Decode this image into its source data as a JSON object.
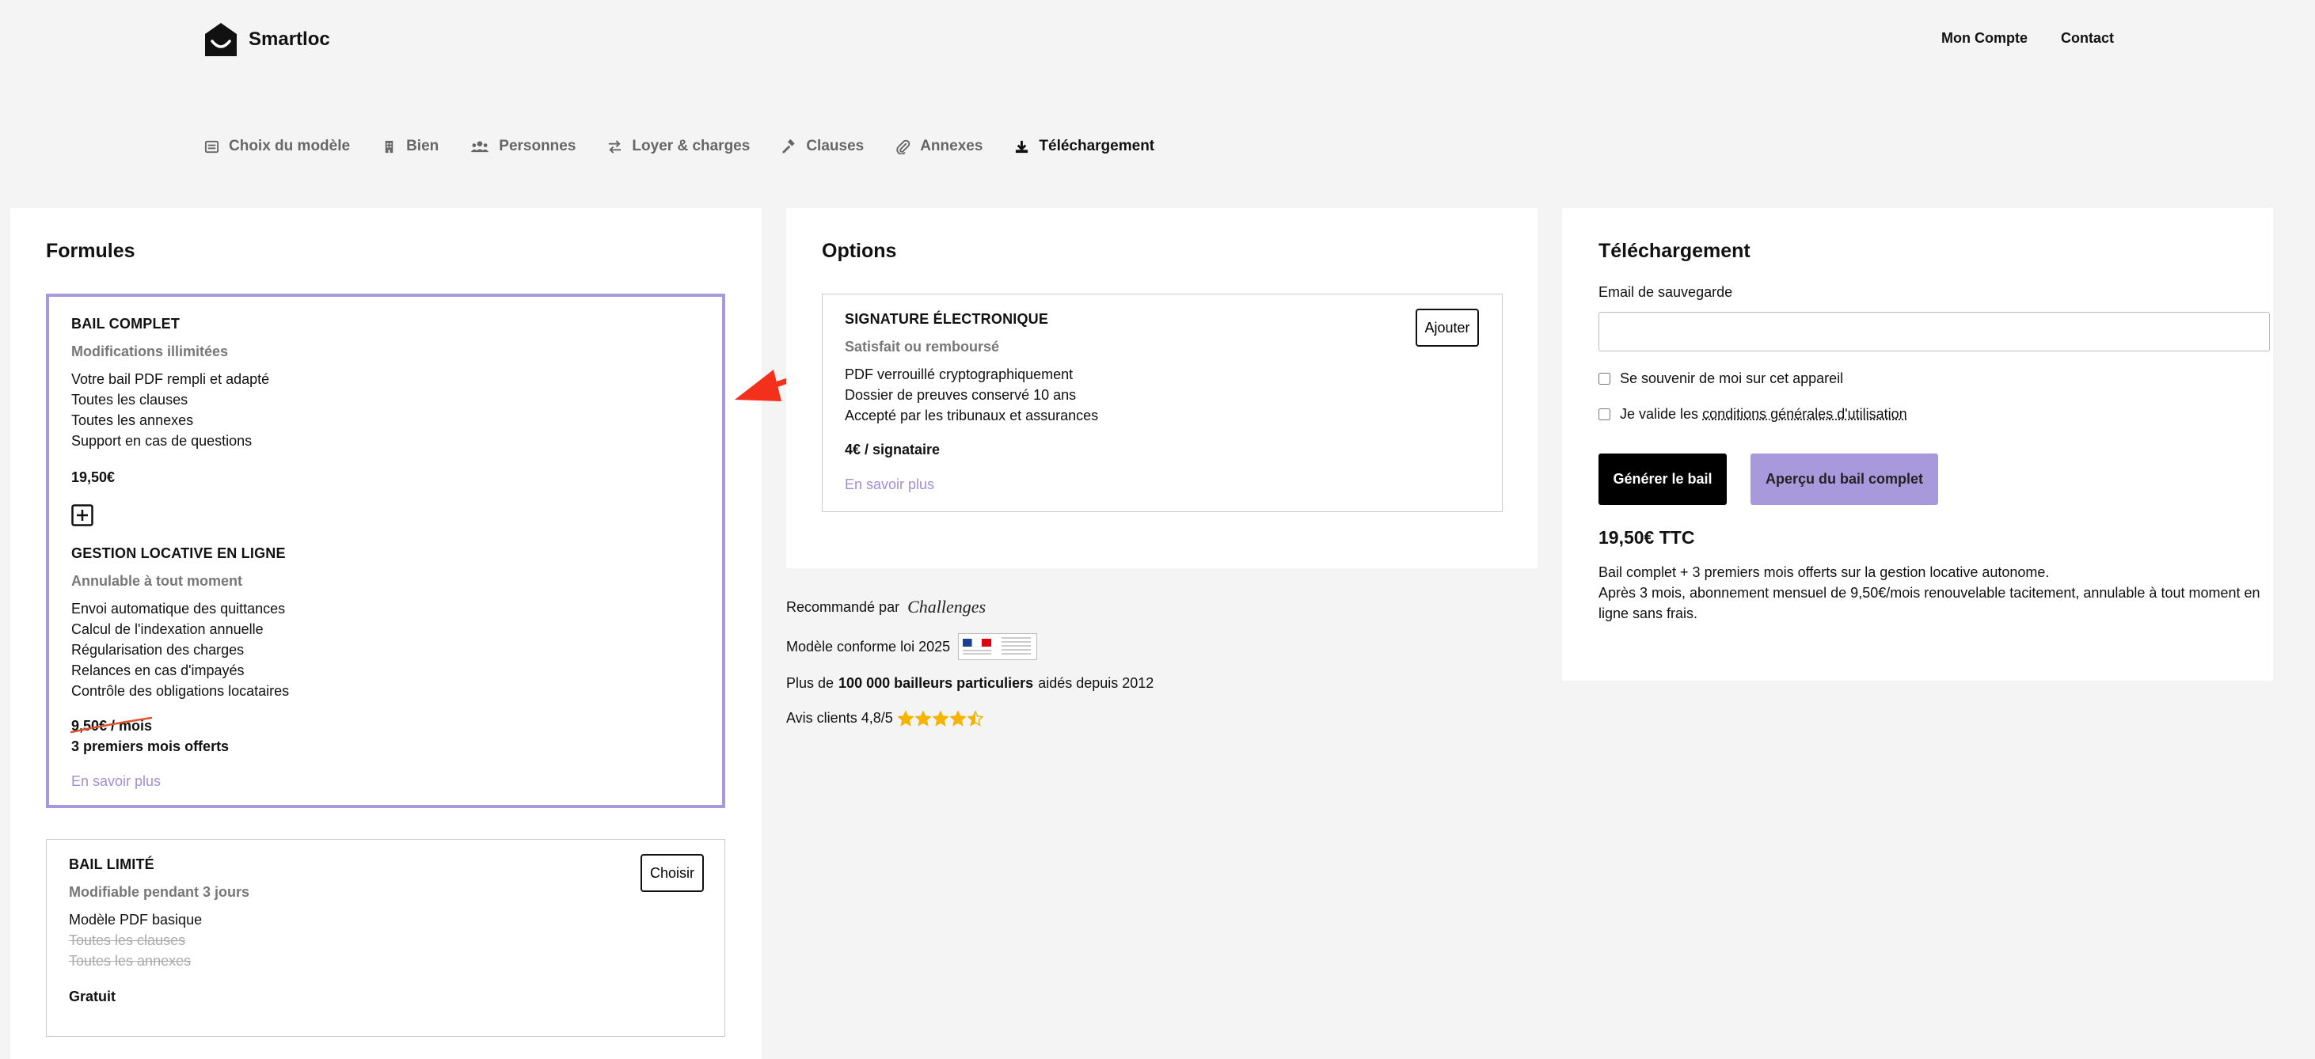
{
  "header": {
    "brand": "Smartloc",
    "nav": [
      "Mon Compte",
      "Contact"
    ]
  },
  "steps": [
    {
      "label": "Choix du modèle",
      "icon": "template-icon"
    },
    {
      "label": "Bien",
      "icon": "building-icon"
    },
    {
      "label": "Personnes",
      "icon": "users-icon"
    },
    {
      "label": "Loyer & charges",
      "icon": "exchange-icon"
    },
    {
      "label": "Clauses",
      "icon": "gavel-icon"
    },
    {
      "label": "Annexes",
      "icon": "paperclip-icon"
    },
    {
      "label": "Téléchargement",
      "icon": "download-icon",
      "active": true
    }
  ],
  "formules": {
    "title": "Formules",
    "bail_complet": {
      "title": "BAIL COMPLET",
      "subtitle": "Modifications illimitées",
      "features": [
        "Votre bail PDF rempli et adapté",
        "Toutes les clauses",
        "Toutes les annexes",
        "Support en cas de questions"
      ],
      "price": "19,50€"
    },
    "gestion": {
      "title": "GESTION LOCATIVE EN LIGNE",
      "subtitle": "Annulable à tout moment",
      "features": [
        "Envoi automatique des quittances",
        "Calcul de l'indexation annuelle",
        "Régularisation des charges",
        "Relances en cas d'impayés",
        "Contrôle des obligations locataires"
      ],
      "old_price": "9,50€ / mois",
      "offer": "3 premiers mois offerts",
      "more": "En savoir plus"
    },
    "bail_limite": {
      "title": "BAIL LIMITÉ",
      "subtitle": "Modifiable pendant 3 jours",
      "feature": "Modèle PDF basique",
      "struck": [
        "Toutes les clauses",
        "Toutes les annexes"
      ],
      "price": "Gratuit",
      "button": "Choisir"
    }
  },
  "options": {
    "title": "Options",
    "signature": {
      "title": "SIGNATURE ÉLECTRONIQUE",
      "subtitle": "Satisfait ou remboursé",
      "features": [
        "PDF verrouillé cryptographiquement",
        "Dossier de preuves conservé 10 ans",
        "Accepté par les tribunaux et assurances"
      ],
      "price": "4€ / signataire",
      "more": "En savoir plus",
      "button": "Ajouter"
    }
  },
  "reco": {
    "recommended_prefix": "Recommandé par",
    "recommended_brand": "Challenges",
    "conform": "Modèle conforme loi 2025",
    "bailleurs_prefix": "Plus de",
    "bailleurs_bold": "100 000 bailleurs particuliers",
    "bailleurs_suffix": "aidés depuis 2012",
    "avis": "Avis clients 4,8/5",
    "rating": 4.5
  },
  "download": {
    "title": "Téléchargement",
    "email_label": "Email de sauvegarde",
    "email_value": "",
    "remember": "Se souvenir de moi sur cet appareil",
    "cgu_prefix": "Je valide les",
    "cgu_link": "conditions générales d'utilisation",
    "generate": "Générer le bail",
    "preview": "Aperçu du bail complet",
    "total": "19,50€ TTC",
    "note_1": "Bail complet + 3 premiers mois offerts sur la gestion locative autonome.",
    "note_2": "Après 3 mois, abonnement mensuel de 9,50€/mois renouvelable tacitement, annulable à tout moment en ligne sans frais."
  },
  "colors": {
    "accent": "#a899dc",
    "link": "#9f8ed6",
    "arrow": "#f2301b",
    "star": "#f5b400"
  }
}
